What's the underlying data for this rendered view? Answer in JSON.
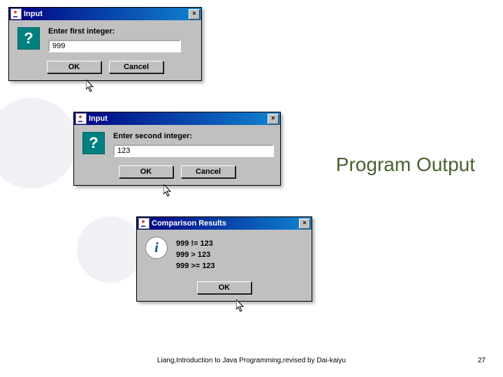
{
  "slide": {
    "title": "Program Output",
    "footer": "Liang,Introduction to Java Programming,revised by Dai-kaiyu",
    "page": "27"
  },
  "dialogs": {
    "first": {
      "title": "Input",
      "prompt": "Enter first integer:",
      "value": "999",
      "ok": "OK",
      "cancel": "Cancel"
    },
    "second": {
      "title": "Input",
      "prompt": "Enter second integer:",
      "value": "123",
      "ok": "OK",
      "cancel": "Cancel"
    },
    "result": {
      "title": "Comparison Results",
      "lines": {
        "l0": "999 != 123",
        "l1": "999 > 123",
        "l2": "999 >= 123"
      },
      "ok": "OK"
    }
  }
}
